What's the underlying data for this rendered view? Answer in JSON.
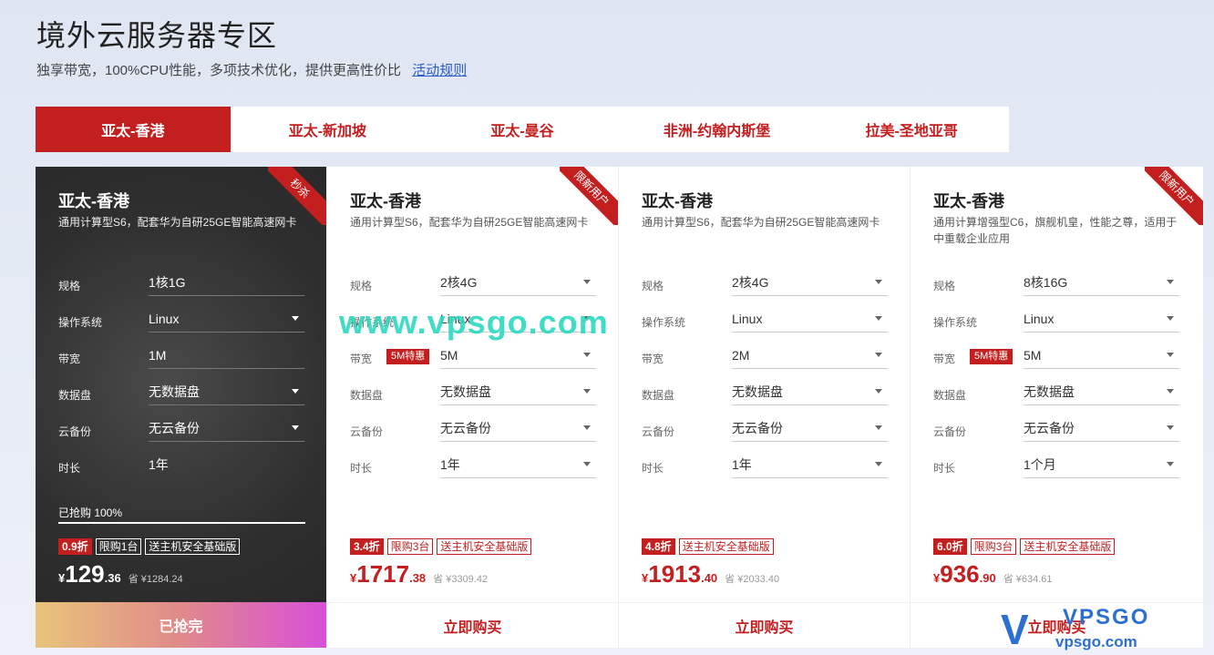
{
  "header": {
    "title": "境外云服务器专区",
    "subtitle": "独享带宽，100%CPU性能，多项技术优化，提供更高性价比",
    "rules_link": "活动规则"
  },
  "tabs": [
    {
      "label": "亚太-香港",
      "active": true
    },
    {
      "label": "亚太-新加坡"
    },
    {
      "label": "亚太-曼谷"
    },
    {
      "label": "非洲-约翰内斯堡"
    },
    {
      "label": "拉美-圣地亚哥"
    }
  ],
  "cards": [
    {
      "ribbon": "秒杀",
      "title": "亚太-香港",
      "desc": "通用计算型S6，配套华为自研25GE智能高速网卡",
      "specs": [
        {
          "label": "规格",
          "value": "1核1G"
        },
        {
          "label": "操作系统",
          "value": "Linux"
        },
        {
          "label": "带宽",
          "value": "1M"
        },
        {
          "label": "数据盘",
          "value": "无数据盘"
        },
        {
          "label": "云备份",
          "value": "无云备份"
        },
        {
          "label": "时长",
          "value": "1年"
        }
      ],
      "progress_label": "已抢购 100%",
      "progress": 100,
      "tags": [
        "0.9折",
        "限购1台",
        "送主机安全基础版"
      ],
      "price": {
        "currency": "¥",
        "int": "129",
        "dec": ".36",
        "save": "省 ¥1284.24"
      },
      "cta": "已抢完"
    },
    {
      "ribbon": "限新用户",
      "title": "亚太-香港",
      "desc": "通用计算型S6，配套华为自研25GE智能高速网卡",
      "specs": [
        {
          "label": "规格",
          "value": "2核4G"
        },
        {
          "label": "操作系统",
          "value": "Linux"
        },
        {
          "label": "带宽",
          "badge": "5M特惠",
          "value": "5M"
        },
        {
          "label": "数据盘",
          "value": "无数据盘"
        },
        {
          "label": "云备份",
          "value": "无云备份"
        },
        {
          "label": "时长",
          "value": "1年"
        }
      ],
      "tags": [
        "3.4折",
        "限购3台",
        "送主机安全基础版"
      ],
      "price": {
        "currency": "¥",
        "int": "1717",
        "dec": ".38",
        "save": "省 ¥3309.42"
      },
      "cta": "立即购买"
    },
    {
      "title": "亚太-香港",
      "desc": "通用计算型S6，配套华为自研25GE智能高速网卡",
      "specs": [
        {
          "label": "规格",
          "value": "2核4G"
        },
        {
          "label": "操作系统",
          "value": "Linux"
        },
        {
          "label": "带宽",
          "value": "2M"
        },
        {
          "label": "数据盘",
          "value": "无数据盘"
        },
        {
          "label": "云备份",
          "value": "无云备份"
        },
        {
          "label": "时长",
          "value": "1年"
        }
      ],
      "tags": [
        "4.8折",
        "送主机安全基础版"
      ],
      "price": {
        "currency": "¥",
        "int": "1913",
        "dec": ".40",
        "save": "省 ¥2033.40"
      },
      "cta": "立即购买"
    },
    {
      "ribbon": "限新用户",
      "title": "亚太-香港",
      "desc": "通用计算增强型C6，旗舰机皇，性能之尊，适用于中重载企业应用",
      "specs": [
        {
          "label": "规格",
          "value": "8核16G"
        },
        {
          "label": "操作系统",
          "value": "Linux"
        },
        {
          "label": "带宽",
          "badge": "5M特惠",
          "value": "5M"
        },
        {
          "label": "数据盘",
          "value": "无数据盘"
        },
        {
          "label": "云备份",
          "value": "无云备份"
        },
        {
          "label": "时长",
          "value": "1个月"
        }
      ],
      "tags": [
        "6.0折",
        "限购3台",
        "送主机安全基础版"
      ],
      "price": {
        "currency": "¥",
        "int": "936",
        "dec": ".90",
        "save": "省 ¥634.61"
      },
      "cta": "立即购买"
    }
  ],
  "watermark": "www.vpsgo.com",
  "logo": {
    "mark": "V",
    "name": "VPSGO",
    "url": "vpsgo.com"
  }
}
